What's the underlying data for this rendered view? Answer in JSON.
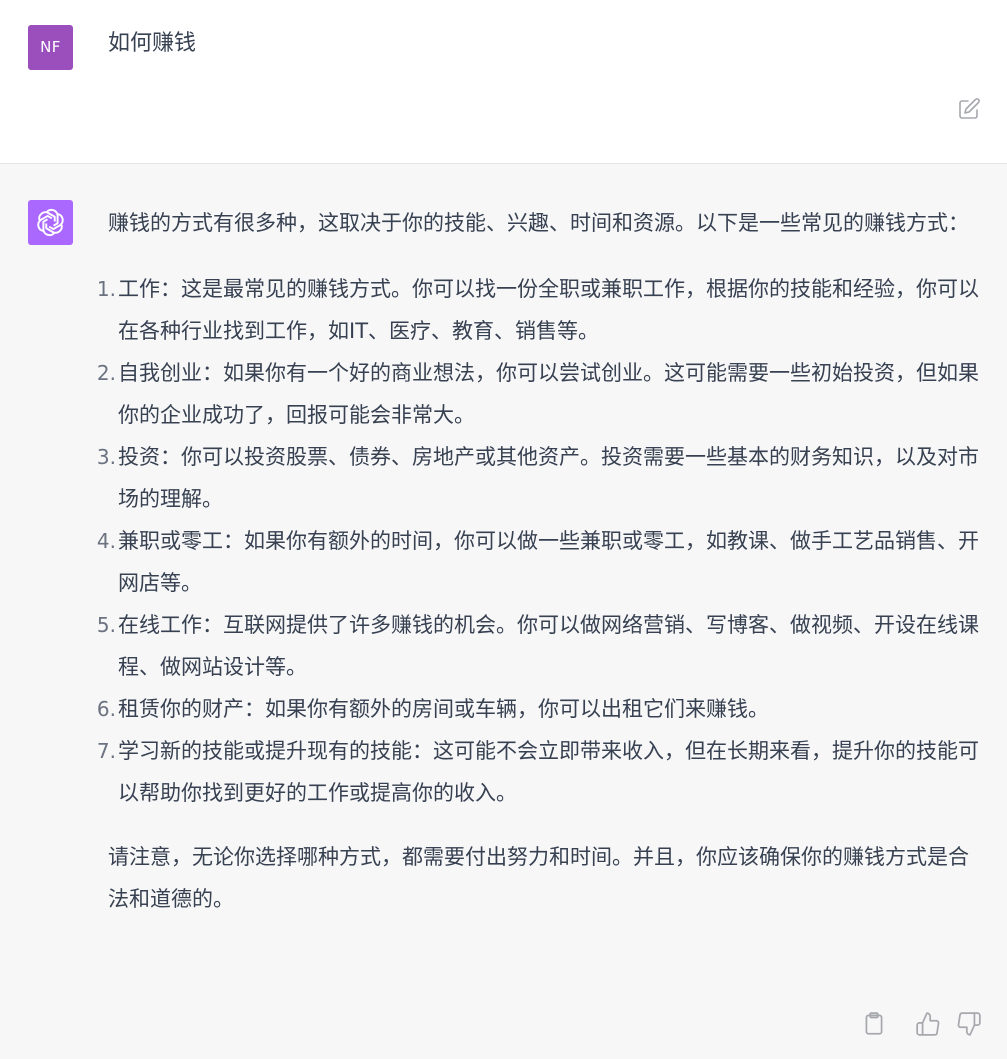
{
  "user_message": {
    "avatar_initials": "NF",
    "text": "如何赚钱"
  },
  "assistant_message": {
    "intro": "赚钱的方式有很多种，这取决于你的技能、兴趣、时间和资源。以下是一些常见的赚钱方式：",
    "items": [
      {
        "num": "1.",
        "text": "工作：这是最常见的赚钱方式。你可以找一份全职或兼职工作，根据你的技能和经验，你可以在各种行业找到工作，如IT、医疗、教育、销售等。"
      },
      {
        "num": "2.",
        "text": "自我创业：如果你有一个好的商业想法，你可以尝试创业。这可能需要一些初始投资，但如果你的企业成功了，回报可能会非常大。"
      },
      {
        "num": "3.",
        "text": "投资：你可以投资股票、债券、房地产或其他资产。投资需要一些基本的财务知识，以及对市场的理解。"
      },
      {
        "num": "4.",
        "text": "兼职或零工：如果你有额外的时间，你可以做一些兼职或零工，如教课、做手工艺品销售、开网店等。"
      },
      {
        "num": "5.",
        "text": "在线工作：互联网提供了许多赚钱的机会。你可以做网络营销、写博客、做视频、开设在线课程、做网站设计等。"
      },
      {
        "num": "6.",
        "text": "租赁你的财产：如果你有额外的房间或车辆，你可以出租它们来赚钱。"
      },
      {
        "num": "7.",
        "text": "学习新的技能或提升现有的技能：这可能不会立即带来收入，但在长期来看，提升你的技能可以帮助你找到更好的工作或提高你的收入。"
      }
    ],
    "outro": "请注意，无论你选择哪种方式，都需要付出努力和时间。并且，你应该确保你的赚钱方式是合法和道德的。"
  },
  "icons": {
    "user_avatar": "user-avatar",
    "bot_avatar": "openai-logo-icon",
    "edit": "edit-icon",
    "copy": "clipboard-icon",
    "thumbs_up": "thumbs-up-icon",
    "thumbs_down": "thumbs-down-icon"
  },
  "colors": {
    "user_avatar_bg": "#9a4fbd",
    "bot_avatar_bg": "#ab68ff",
    "assistant_bg": "#f7f7f8"
  }
}
